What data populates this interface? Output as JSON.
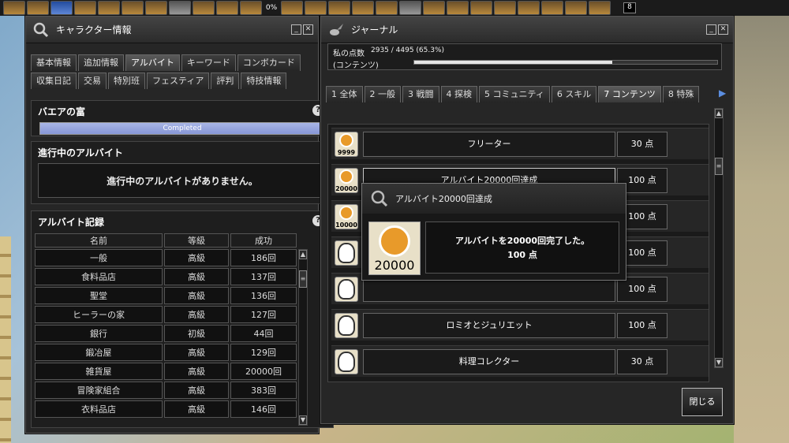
{
  "topbar": {
    "percent": "0%",
    "badge": "8"
  },
  "char_window": {
    "title": "キャラクター情報",
    "tabs_row1": [
      "基本情報",
      "追加情報",
      "アルバイト",
      "キーワード",
      "コンボカード"
    ],
    "tabs_row2": [
      "収集日記",
      "交易",
      "特別班",
      "フェスティア",
      "評判",
      "特技情報"
    ],
    "active_tab": "アルバイト",
    "wealth": {
      "title": "バエアの富",
      "status": "Completed",
      "help": "?"
    },
    "ongoing": {
      "title": "進行中のアルバイト",
      "empty_message": "進行中のアルバイトがありません。"
    },
    "records": {
      "title": "アルバイト記録",
      "help": "?",
      "headers": [
        "名前",
        "等級",
        "成功"
      ],
      "rows": [
        {
          "name": "一般",
          "grade": "高級",
          "count": "186回"
        },
        {
          "name": "食料品店",
          "grade": "高級",
          "count": "137回"
        },
        {
          "name": "聖堂",
          "grade": "高級",
          "count": "136回"
        },
        {
          "name": "ヒーラーの家",
          "grade": "高級",
          "count": "127回"
        },
        {
          "name": "銀行",
          "grade": "初級",
          "count": "44回"
        },
        {
          "name": "鍛冶屋",
          "grade": "高級",
          "count": "129回"
        },
        {
          "name": "雑貨屋",
          "grade": "高級",
          "count": "20000回"
        },
        {
          "name": "冒険家組合",
          "grade": "高級",
          "count": "383回"
        },
        {
          "name": "衣料品店",
          "grade": "高級",
          "count": "146回"
        }
      ]
    }
  },
  "journal": {
    "title": "ジャーナル",
    "score": {
      "label": "私の点数",
      "value": "2935 / 4495 (65.3%)",
      "category": "(コンテンツ)",
      "fraction": 0.653
    },
    "tabs": [
      "1 全体",
      "2 一般",
      "3 戦闘",
      "4 探検",
      "5 コミュニティ",
      "6 スキル",
      "7 コンテンツ",
      "8 特殊"
    ],
    "active_tab": "7 コンテンツ",
    "items": [
      {
        "medal": "9999",
        "name": "フリーター",
        "points": "30 点"
      },
      {
        "medal": "20000",
        "name": "アルバイト20000回達成",
        "points": "100 点"
      },
      {
        "medal": "10000",
        "name": "",
        "points": "100 点"
      },
      {
        "medal": "",
        "name": "",
        "points": "100 点"
      },
      {
        "medal": "",
        "name": "",
        "points": "100 点"
      },
      {
        "medal": "",
        "name": "ロミオとジュリエット",
        "points": "100 点"
      },
      {
        "medal": "",
        "name": "料理コレクター",
        "points": "30 点"
      }
    ],
    "tooltip": {
      "title": "アルバイト20000回達成",
      "medal": "20000",
      "line1": "アルバイトを20000回完了した。",
      "line2": "100 点"
    },
    "close_label": "閉じる"
  }
}
